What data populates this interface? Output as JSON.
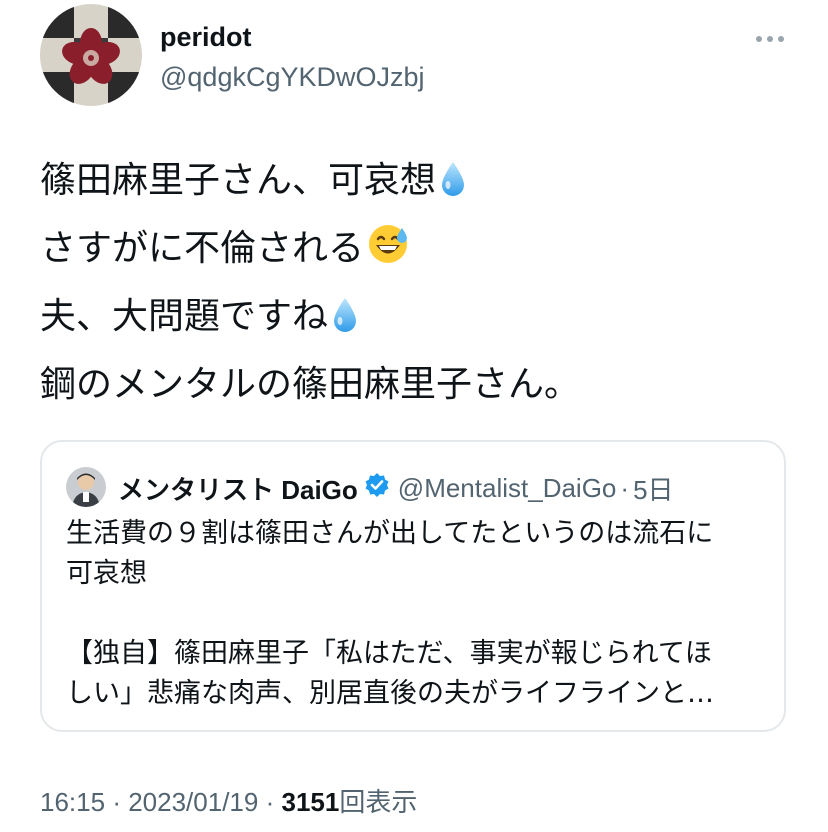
{
  "author": {
    "display_name": "peridot",
    "handle": "@qdgkCgYKDwOJzbj"
  },
  "menu_icon": "more-horizontal-icon",
  "tweet_lines": [
    "篠田麻里子さん、可哀想",
    "さすがに不倫される",
    "夫、大問題ですね",
    "鋼のメンタルの篠田麻里子さん。"
  ],
  "emojis": [
    "droplet-emoji",
    "grinning-sweat-emoji",
    "droplet-emoji"
  ],
  "quoted_tweet": {
    "display_name": "メンタリスト DaiGo",
    "handle": "@Mentalist_DaiGo",
    "separator": "·",
    "time": "5日",
    "verified": true,
    "text_lines": [
      "生活費の９割は篠田さんが出してたというのは流石に",
      "可哀想"
    ],
    "link_lines": [
      "【独自】篠田麻里子「私はただ、事実が報じられてほ",
      "しい」悲痛な肉声、別居直後の夫がライフラインと…"
    ]
  },
  "meta": {
    "time": "16:15",
    "separator": "·",
    "date": "2023/01/19",
    "views_count": "3151",
    "views_label": "回表示"
  },
  "colors": {
    "text": "#0f1419",
    "secondary": "#536471",
    "border": "#e4e8ea",
    "verified": "#1d9bf0"
  }
}
